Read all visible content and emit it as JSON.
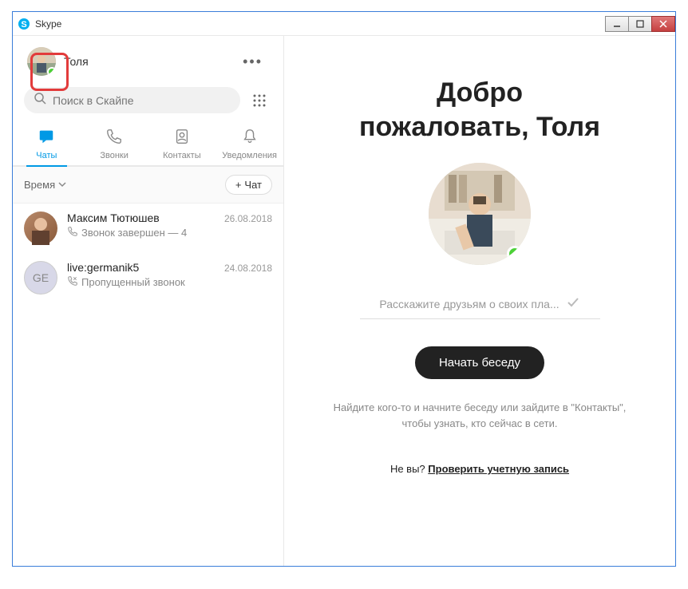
{
  "window": {
    "title": "Skype"
  },
  "profile": {
    "name": "Толя",
    "status": "online"
  },
  "search": {
    "placeholder": "Поиск в Скайпе"
  },
  "tabs": [
    {
      "label": "Чаты",
      "icon": "chat"
    },
    {
      "label": "Звонки",
      "icon": "phone"
    },
    {
      "label": "Контакты",
      "icon": "contacts"
    },
    {
      "label": "Уведомления",
      "icon": "bell"
    }
  ],
  "filter": {
    "label": "Время"
  },
  "new_chat": {
    "label": "Чат"
  },
  "chats": [
    {
      "name": "Максим Тютюшев",
      "date": "26.08.2018",
      "sub": "Звонок завершен — 4",
      "initials": "",
      "sub_icon": "phone"
    },
    {
      "name": "live:germanik5",
      "date": "24.08.2018",
      "sub": "Пропущенный звонок",
      "initials": "GE",
      "sub_icon": "missed"
    }
  ],
  "welcome": {
    "title_line1": "Добро",
    "title_line2": "пожаловать, Толя",
    "status_placeholder": "Расскажите друзьям о своих пла...",
    "start_button": "Начать беседу",
    "hint": "Найдите кого-то и начните беседу или зайдите в \"Контакты\", чтобы узнать, кто сейчас в сети.",
    "not_you_prefix": "Не вы? ",
    "not_you_link": "Проверить учетную запись"
  }
}
